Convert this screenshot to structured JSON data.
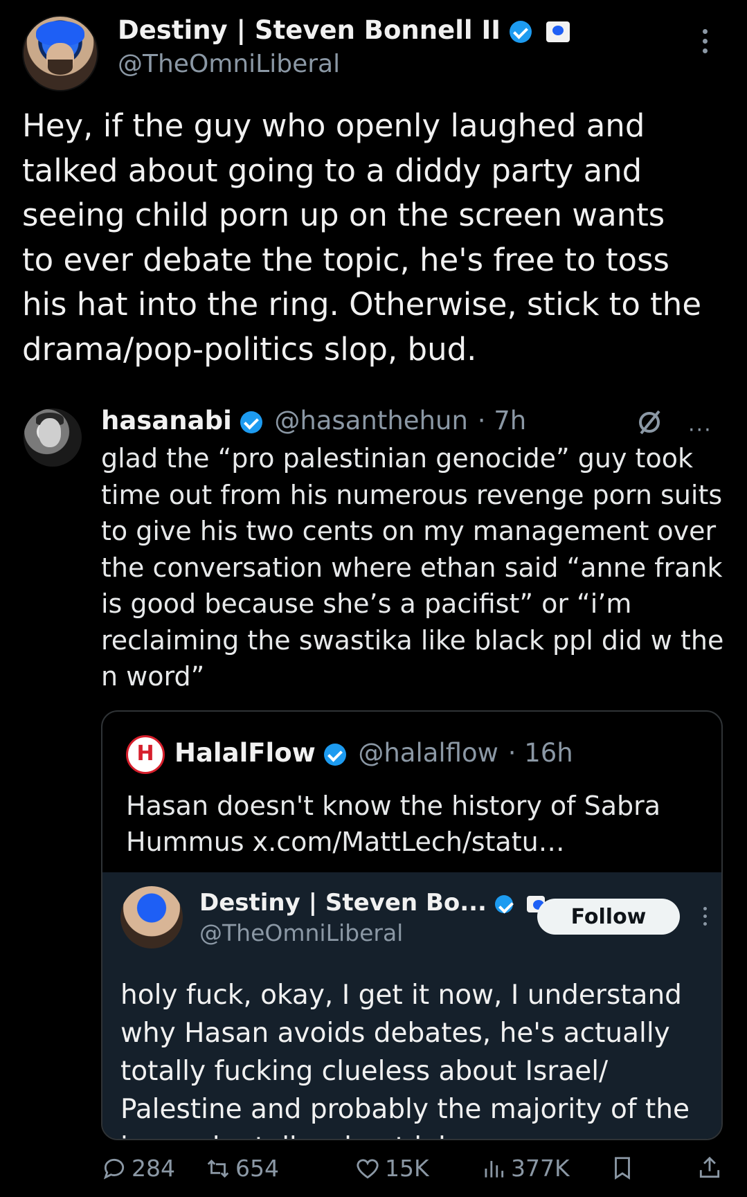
{
  "tweet": {
    "author_name": "Destiny | Steven Bonnell II",
    "author_handle": "@TheOmniLiberal",
    "text": "Hey, if the guy who openly laughed and\ntalked about going to a diddy party and\nseeing child porn up on the screen wants\nto ever debate the topic, he's free to toss\nhis hat into the ring. Otherwise, stick to the\ndrama/pop-politics slop, bud."
  },
  "quoted": {
    "author_name": "hasanabi",
    "author_handle": "@hasanthehun",
    "time": "· 7h",
    "text": "glad the “pro palestinian genocide” guy took\ntime out from his numerous revenge porn suits\nto give his two cents on my management over\nthe conversation where ethan said “anne frank\nis good because she’s a pacifist” or “i’m\nreclaiming the swastika like black ppl did w the\nn word”",
    "more_label": "···"
  },
  "nested": {
    "author_name": "HalalFlow",
    "author_handle": "@halalflow",
    "time": "· 16h",
    "text": "Hasan doesn't know the history of Sabra\nHummus x.com/MattLech/statu…"
  },
  "embed": {
    "author_name": "Destiny | Steven Bo...",
    "author_handle": "@TheOmniLiberal",
    "follow_label": "Follow",
    "text": "holy fuck, okay, I get it now, I understand\nwhy Hasan avoids debates, he's actually\ntotally fucking clueless about Israel/\nPalestine and probably the majority of the\nissues he talks about lol"
  },
  "actions": {
    "replies": "284",
    "reposts": "654",
    "likes": "15K",
    "views": "377K"
  },
  "colors": {
    "background": "#000000",
    "text": "#e7e9ea",
    "muted": "#8b98a5",
    "verified": "#1d9bf0",
    "embed_bg": "#15202b"
  }
}
